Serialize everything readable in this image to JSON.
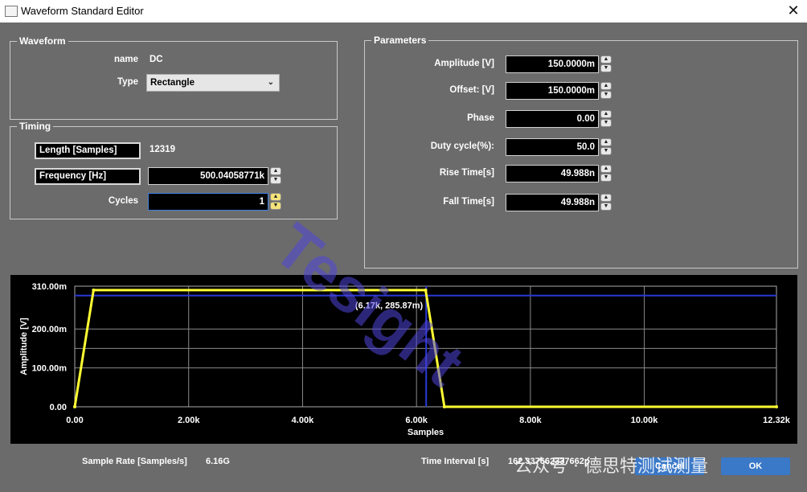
{
  "window": {
    "title": "Waveform Standard Editor"
  },
  "waveform": {
    "title": "Waveform",
    "name_label": "name",
    "name_value": "DC",
    "type_label": "Type",
    "type_value": "Rectangle"
  },
  "timing": {
    "title": "Timing",
    "length_label": "Length [Samples]",
    "length_value": "12319",
    "frequency_label": "Frequency [Hz]",
    "frequency_value": "500.04058771k",
    "cycles_label": "Cycles",
    "cycles_value": "1"
  },
  "parameters": {
    "title": "Parameters",
    "rows": [
      {
        "label": "Amplitude [V]",
        "value": "150.0000m"
      },
      {
        "label": "Offset: [V]",
        "value": "150.0000m"
      },
      {
        "label": "Phase",
        "value": "0.00"
      },
      {
        "label": "Duty cycle(%):",
        "value": "50.0"
      },
      {
        "label": "Rise Time[s]",
        "value": "49.988n"
      },
      {
        "label": "Fall Time[s]",
        "value": "49.988n"
      }
    ]
  },
  "chart_data": {
    "type": "line",
    "xlabel": "Samples",
    "ylabel": "Amplitude [V]",
    "xlim": [
      0,
      12320
    ],
    "ylim": [
      0,
      0.31
    ],
    "x_ticks": [
      "0.00",
      "2.00k",
      "4.00k",
      "6.00k",
      "8.00k",
      "10.00k",
      "12.32k"
    ],
    "y_ticks": [
      "0.00",
      "100.00m",
      "200.00m",
      "310.00m"
    ],
    "series": [
      {
        "color": "#ffff33",
        "x": [
          0,
          330,
          6160,
          6490,
          12320
        ],
        "y": [
          0.0,
          0.3,
          0.3,
          0.0,
          0.0
        ]
      }
    ],
    "cursor": {
      "label": "(6.17k, 285.87m)",
      "x": 6170,
      "y": 0.28587,
      "color": "#2b39d6"
    }
  },
  "footer": {
    "sample_rate_label": "Sample Rate [Samples/s]",
    "sample_rate_value": "6.16G",
    "time_interval_label": "Time Interval [s]",
    "time_interval_value": "162.337662337662p",
    "cancel_label": "Cancel",
    "ok_label": "OK"
  },
  "watermark": {
    "brand": "Tesight",
    "text": "公众号 · 德思特测试测量"
  }
}
